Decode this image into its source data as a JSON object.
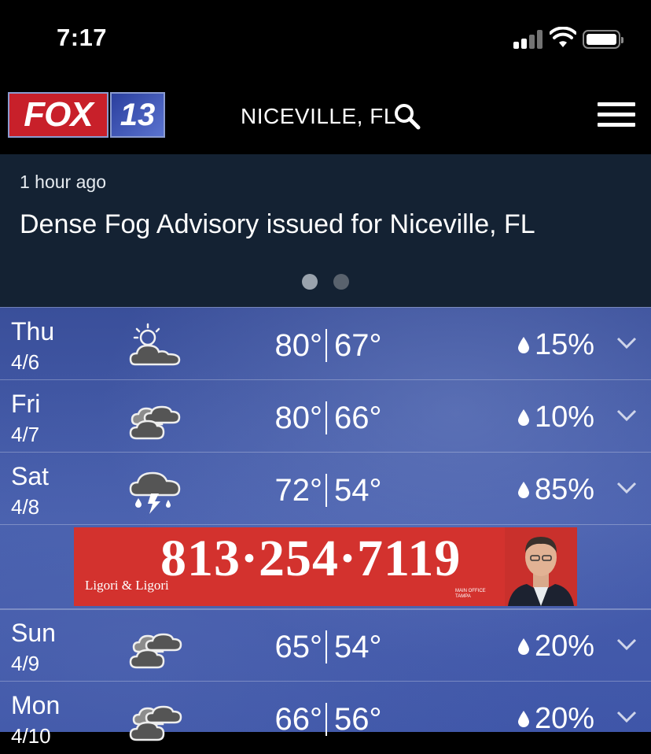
{
  "status_bar": {
    "time": "7:17"
  },
  "header": {
    "logo_left": "FOX",
    "logo_right": "13",
    "location": "NICEVILLE, FL"
  },
  "alert": {
    "time_ago": "1 hour ago",
    "headline": "Dense Fog Advisory issued for Niceville, FL",
    "pages": 2,
    "active_page": 1
  },
  "forecast": {
    "days": [
      {
        "dow": "Thu",
        "date": "4/6",
        "icon": "partly-sunny-icon",
        "high": "80°",
        "low": "67°",
        "precip": "15%"
      },
      {
        "dow": "Fri",
        "date": "4/7",
        "icon": "mostly-cloudy-icon",
        "high": "80°",
        "low": "66°",
        "precip": "10%"
      },
      {
        "dow": "Sat",
        "date": "4/8",
        "icon": "thunderstorm-icon",
        "high": "72°",
        "low": "54°",
        "precip": "85%"
      },
      {
        "dow": "Sun",
        "date": "4/9",
        "icon": "cloudy-icon",
        "high": "65°",
        "low": "54°",
        "precip": "20%"
      },
      {
        "dow": "Mon",
        "date": "4/10",
        "icon": "cloudy-icon",
        "high": "66°",
        "low": "56°",
        "precip": "20%"
      }
    ]
  },
  "ad": {
    "phone": "813·254·7119",
    "firm": "Ligori & Ligori",
    "office": "MAIN OFFICE TAMPA",
    "brand_color": "#d3322e"
  },
  "colors": {
    "alert_bg": "#142233",
    "fox_red": "#c8202a",
    "forecast_blue": "#475fae"
  }
}
